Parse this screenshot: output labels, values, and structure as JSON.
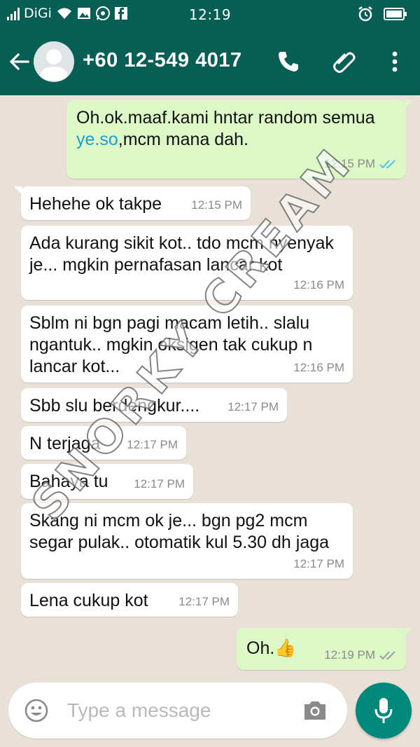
{
  "status_bar": {
    "carrier": "DiGi",
    "time": "12:19",
    "colors": {
      "bar": "#075e54"
    }
  },
  "header": {
    "contact": "+60 12-549 4017",
    "icons": [
      "back-arrow-icon",
      "avatar",
      "phone-icon",
      "attach-icon",
      "more-icon"
    ]
  },
  "messages": [
    {
      "dir": "out",
      "text_parts": [
        "Oh.ok.maaf.kami hntar random semua ",
        "ye.so",
        ",mcm mana dah."
      ],
      "time": "12:15 PM",
      "ticks": "read"
    },
    {
      "dir": "in",
      "text": "Hehehe ok takpe",
      "time": "12:15 PM"
    },
    {
      "dir": "in",
      "text": "Ada kurang sikit kot.. tdo mcm nyenyak je... mgkin pernafasan lancar kot",
      "time": "12:16 PM"
    },
    {
      "dir": "in",
      "text": "Sblm ni bgn pagi macam letih.. slalu ngantuk.. mgkin oksigen tak cukup n lancar kot...",
      "time": "12:16 PM"
    },
    {
      "dir": "in",
      "text": "Sbb slu berdengkur....",
      "time": "12:17 PM"
    },
    {
      "dir": "in",
      "text": "N terjaga",
      "time": "12:17 PM"
    },
    {
      "dir": "in",
      "text": "Bahaya tu",
      "time": "12:17 PM"
    },
    {
      "dir": "in",
      "text": "Skang ni mcm ok je... bgn pg2 mcm segar pulak.. otomatik kul 5.30 dh jaga",
      "time": "12:17 PM"
    },
    {
      "dir": "in",
      "text": "Lena cukup kot",
      "time": "12:17 PM"
    },
    {
      "dir": "out",
      "text": "Oh.",
      "emoji": "👍",
      "time": "12:19 PM",
      "ticks": "delivered"
    }
  ],
  "input": {
    "placeholder": "Type a message"
  },
  "watermark": "SNORKY CREAM",
  "colors": {
    "header": "#075e54",
    "outgoing_bubble": "#dcf8c6",
    "incoming_bubble": "#ffffff",
    "read_tick": "#4fc3f7",
    "mic_button": "#00897b"
  }
}
